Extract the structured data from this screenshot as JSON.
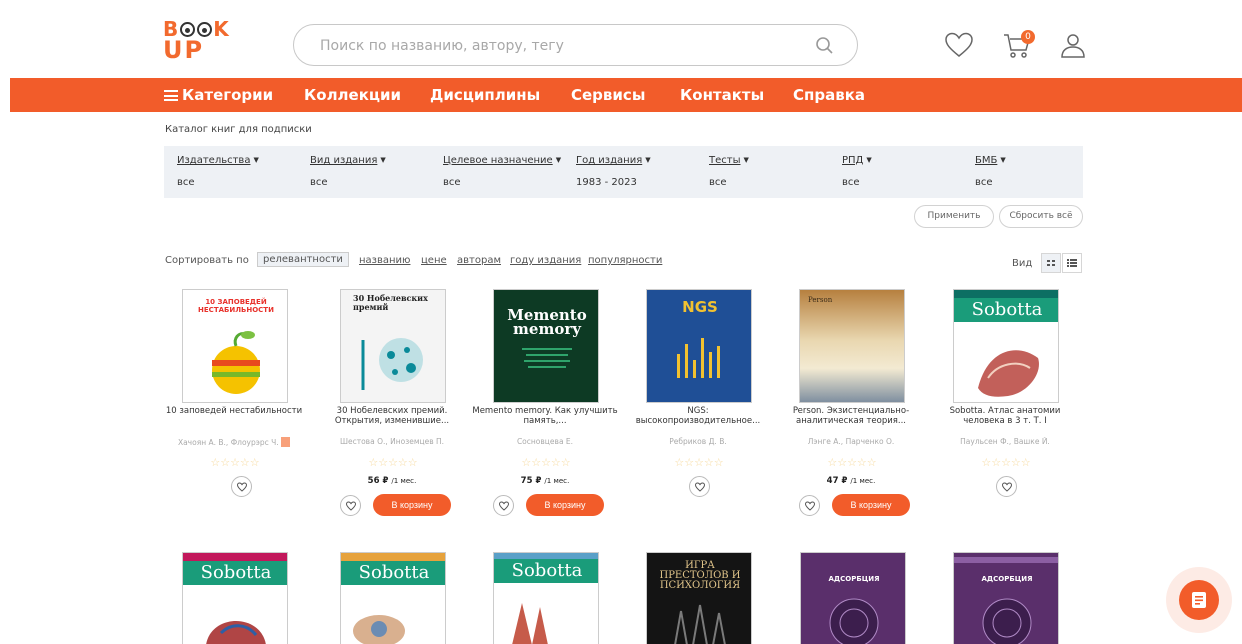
{
  "header": {
    "logo_top": "BOOK",
    "logo_bottom": "UP",
    "search_placeholder": "Поиск по названию, автору, тегу",
    "cart_count": "0"
  },
  "nav": {
    "items": [
      "Категории",
      "Коллекции",
      "Дисциплины",
      "Сервисы",
      "Контакты",
      "Справка"
    ]
  },
  "catalog": {
    "title": "Каталог книг для подписки",
    "filters": [
      {
        "label": "Издательства",
        "value": "все"
      },
      {
        "label": "Вид издания",
        "value": "все"
      },
      {
        "label": "Целевое назначение",
        "value": "все"
      },
      {
        "label": "Год издания",
        "value": "1983 - 2023"
      },
      {
        "label": "Тесты",
        "value": "все"
      },
      {
        "label": "РПД",
        "value": "все"
      },
      {
        "label": "БМБ",
        "value": "все"
      }
    ],
    "apply_label": "Применить",
    "reset_label": "Сбросить всё",
    "sort_label": "Сортировать по",
    "sort_options": [
      "релевантности",
      "названию",
      "цене",
      "авторам",
      "году издания",
      "популярности"
    ],
    "view_label": "Вид"
  },
  "books": [
    {
      "title": "10 заповедей нестабильности",
      "author": "Хачоян А. В., Флоурэрс Ч.",
      "price": "",
      "cover_text": "10 ЗАПОВЕДЕЙ НЕСТАБИЛЬНОСТИ",
      "cover_bg": "#ffffff"
    },
    {
      "title": "30 Нобелевских премий. Открытия, изменившие...",
      "author": "Шестова О., Иноземцев П.",
      "price": "56 ₽",
      "cover_text": "30 Нобелевских премий",
      "cover_bg": "#f4f4f4"
    },
    {
      "title": "Memento memory. Как улучшить память,...",
      "author": "Сосновцева Е.",
      "price": "75 ₽",
      "cover_text": "Memento memory",
      "cover_bg": "#0d3a24"
    },
    {
      "title": "NGS: высокопроизводительное...",
      "author": "Ребриков Д. В.",
      "price": "",
      "cover_text": "NGS",
      "cover_bg": "#1f4f96"
    },
    {
      "title": "Person. Экзистенциально-аналитическая теория...",
      "author": "Лэнге А., Парченко О.",
      "price": "47 ₽",
      "cover_text": "Person",
      "cover_bg": "#d9b98a"
    },
    {
      "title": "Sobotta. Атлас анатомии человека в 3 т. Т. I",
      "author": "Паульсен Ф., Вашке Й.",
      "price": "",
      "cover_text": "Sobotta",
      "cover_bg": "#1a9c7a"
    }
  ],
  "books_row2": [
    {
      "cover_text": "Sobotta",
      "cover_bg": "#1a9c7a"
    },
    {
      "cover_text": "Sobotta",
      "cover_bg": "#1a9c7a"
    },
    {
      "cover_text": "Sobotta",
      "cover_bg": "#1a9c7a"
    },
    {
      "cover_text": "ИГРА ПРЕСТОЛОВ И ПСИХОЛОГИЯ",
      "cover_bg": "#141414"
    },
    {
      "cover_text": "АДСОРБЦИЯ",
      "cover_bg": "#5a2f6b"
    },
    {
      "cover_text": "АДСОРБЦИЯ",
      "cover_bg": "#5a2f6b"
    }
  ],
  "labels": {
    "per_month": "/1 мес.",
    "to_cart": "В корзину",
    "stars": "☆☆☆☆☆"
  }
}
